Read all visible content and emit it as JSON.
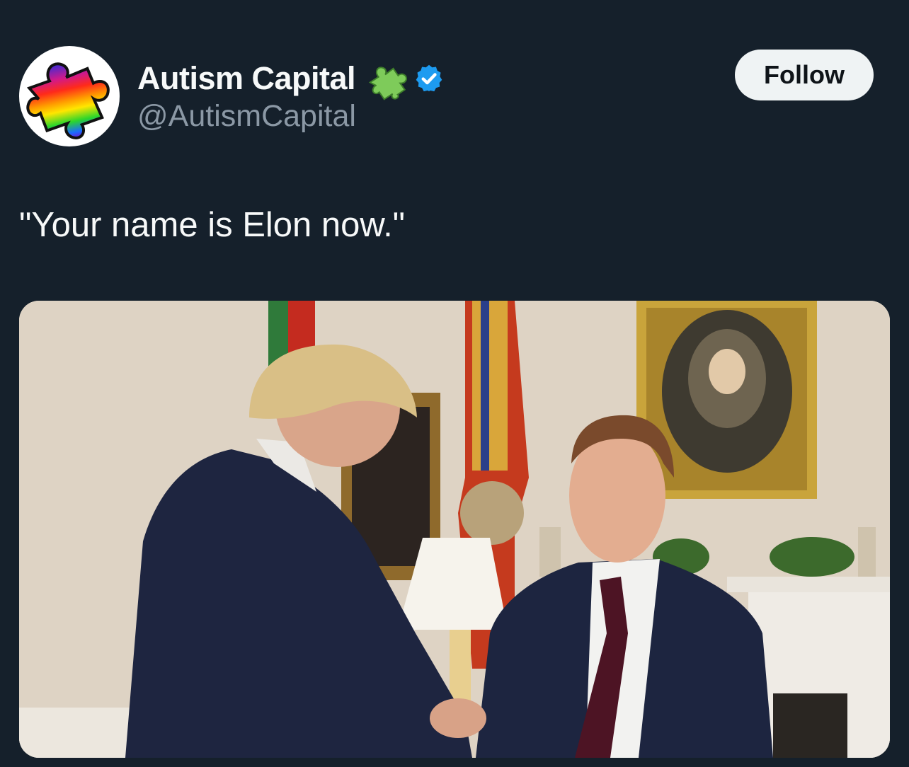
{
  "tweet": {
    "author": {
      "display_name": "Autism Capital",
      "handle": "@AutismCapital",
      "avatar_icon": "rainbow-puzzle-piece-icon",
      "name_badge_icon": "green-puzzle-piece-icon",
      "verified": true,
      "verified_icon": "verified-checkmark-icon"
    },
    "follow_label": "Follow",
    "text": "\"Your name is Elon now.\"",
    "media": {
      "type": "photo",
      "description_icon": "photo-two-men-shaking-hands-in-office"
    }
  },
  "colors": {
    "background": "#15202b",
    "primary_text": "#f7f9f9",
    "secondary_text": "#8b98a5",
    "verified_blue": "#1d9bf0",
    "follow_button_bg": "#eff3f4",
    "follow_button_text": "#0f1419"
  }
}
